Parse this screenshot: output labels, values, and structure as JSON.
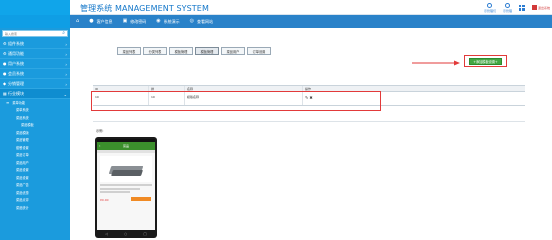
{
  "header": {
    "title": "管理系统 MANAGEMENT SYSTEM",
    "right_items": [
      {
        "icon": "user-icon",
        "label": "示管理们"
      },
      {
        "icon": "bell-icon",
        "label": "示管理"
      }
    ],
    "grid_icon": "grid-icon",
    "exit_label": "退出系统"
  },
  "topnav": {
    "items": [
      {
        "icon": "home-icon",
        "label": ""
      },
      {
        "icon": "person-icon",
        "label": "客户信息"
      },
      {
        "icon": "lock-icon",
        "label": "修改密码"
      },
      {
        "icon": "globe-icon",
        "label": "系统演示"
      },
      {
        "icon": "eye-icon",
        "label": "查看网站"
      }
    ]
  },
  "sidebar": {
    "search_placeholder": "输入搜索",
    "menu": [
      {
        "label": "组件系统",
        "icon": "gear-icon"
      },
      {
        "label": "通用功能",
        "icon": "gear-icon"
      },
      {
        "label": "用户系统",
        "icon": "user-icon"
      },
      {
        "label": "会员系统",
        "icon": "user-icon"
      },
      {
        "label": "分销管理",
        "icon": "share-icon"
      },
      {
        "label": "行业模块",
        "icon": "grid-icon"
      }
    ],
    "sub_header": "菜单功能",
    "sub_items": [
      {
        "label": "菜单系统",
        "indent": false
      },
      {
        "label": "菜品系统",
        "indent": false
      },
      {
        "label": "菜品模板",
        "indent": true
      },
      {
        "label": "菜品模版",
        "indent": false
      },
      {
        "label": "菜品管理",
        "indent": false
      },
      {
        "label": "套餐设置",
        "indent": false
      },
      {
        "label": "菜品订单",
        "indent": false
      },
      {
        "label": "菜品用户",
        "indent": false
      },
      {
        "label": "菜品设置",
        "indent": false
      },
      {
        "label": "菜品设置",
        "indent": false
      },
      {
        "label": "菜品广告",
        "indent": false
      },
      {
        "label": "菜品优惠",
        "indent": false
      },
      {
        "label": "菜品点评",
        "indent": false
      },
      {
        "label": "菜品统计",
        "indent": false
      }
    ]
  },
  "main": {
    "tabs": [
      {
        "label": "菜品列表",
        "active": false
      },
      {
        "label": "分类列表",
        "active": false
      },
      {
        "label": "模板管理",
        "active": false
      },
      {
        "label": "模板管理",
        "active": true
      },
      {
        "label": "菜品用户",
        "active": false
      },
      {
        "label": "订单设置",
        "active": false
      }
    ],
    "add_button": "+添加模板设置+",
    "table": {
      "headers": [
        "ID",
        "排",
        "名称",
        "操作"
      ],
      "rows": [
        {
          "id": "10",
          "sort": "10",
          "name": "模版名称"
        }
      ]
    },
    "preview_label": "示例:",
    "phone": {
      "title": "菜品",
      "price": "¥0.00"
    }
  },
  "colors": {
    "accent": "#1b9bdd",
    "nav": "#2a82c9",
    "highlight": "#e23a3a",
    "add_button": "#42a642"
  }
}
